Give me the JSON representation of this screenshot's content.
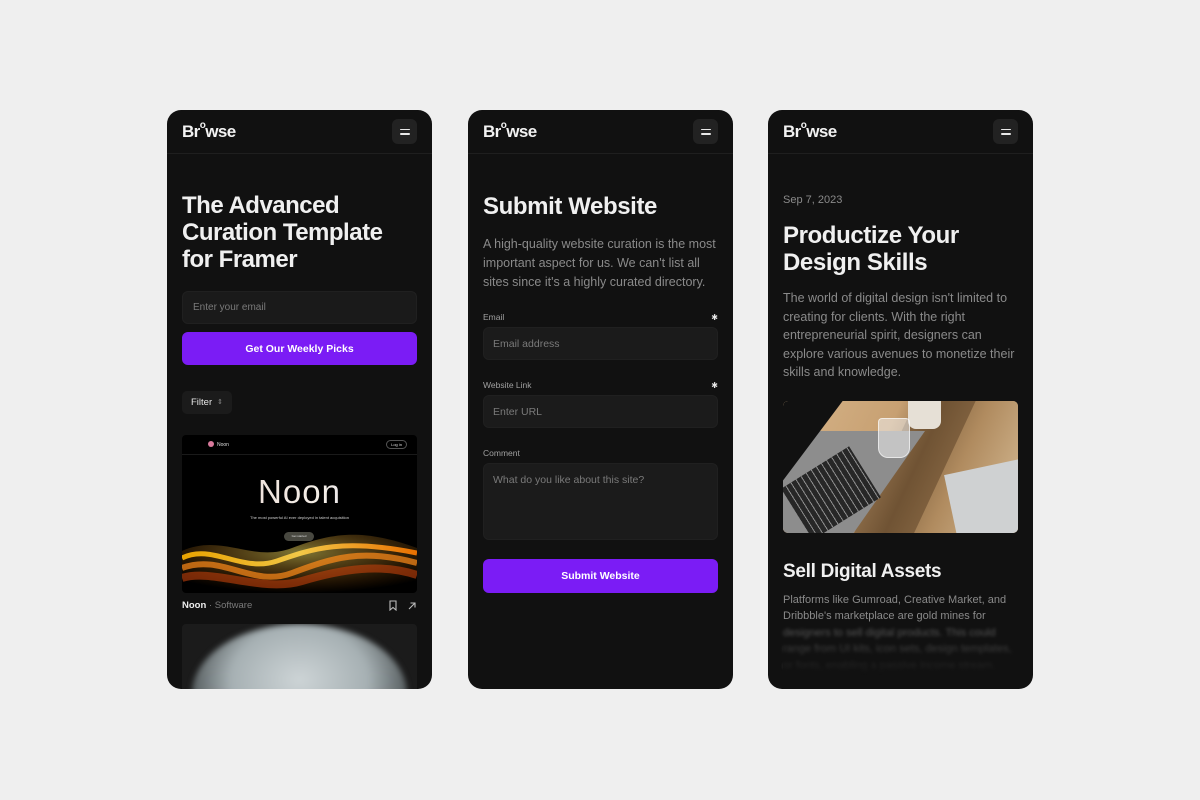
{
  "brand": {
    "logo_prefix": "Br",
    "logo_sup": "o",
    "logo_suffix": "wse"
  },
  "colors": {
    "accent": "#7b1cf5",
    "panel": "#111111",
    "background": "#efefef"
  },
  "home": {
    "hero_title": "The Advanced Curation Template for Framer",
    "email_placeholder": "Enter your email",
    "cta_label": "Get Our Weekly Picks",
    "filter_label": "Filter",
    "items": [
      {
        "name": "Noon",
        "separator": "·",
        "category": "Software",
        "preview": {
          "brand": "Noon",
          "login": "Log in",
          "headline": "Noon",
          "subline": "The most powerful AI ever deployed in talent acquisition",
          "cta": "Get started"
        },
        "icons": [
          "bookmark-icon",
          "arrow-up-right-icon"
        ]
      }
    ]
  },
  "submit": {
    "title": "Submit Website",
    "intro": "A high-quality website curation is the most important aspect for us. We can't list all sites since it's a highly curated directory.",
    "fields": [
      {
        "label": "Email",
        "placeholder": "Email address",
        "required_mark": "✱"
      },
      {
        "label": "Website Link",
        "placeholder": "Enter URL",
        "required_mark": "✱"
      },
      {
        "label": "Comment",
        "placeholder": "What do you like about this site?"
      }
    ],
    "submit_label": "Submit Website"
  },
  "article": {
    "date": "Sep 7, 2023",
    "title": "Productize Your Design Skills",
    "body": "The world of digital design isn't limited to creating for clients. With the right entrepreneurial spirit, designers can explore various avenues to monetize their skills and knowledge.",
    "section_title": "Sell Digital Assets",
    "section_lines": [
      "Platforms like Gumroad, Creative Market, and",
      "Dribbble's marketplace are gold mines for",
      "designers to sell digital products. This could",
      "range from UI kits, icon sets, design templates,",
      "or fonts, enabling a passive income stream."
    ]
  }
}
